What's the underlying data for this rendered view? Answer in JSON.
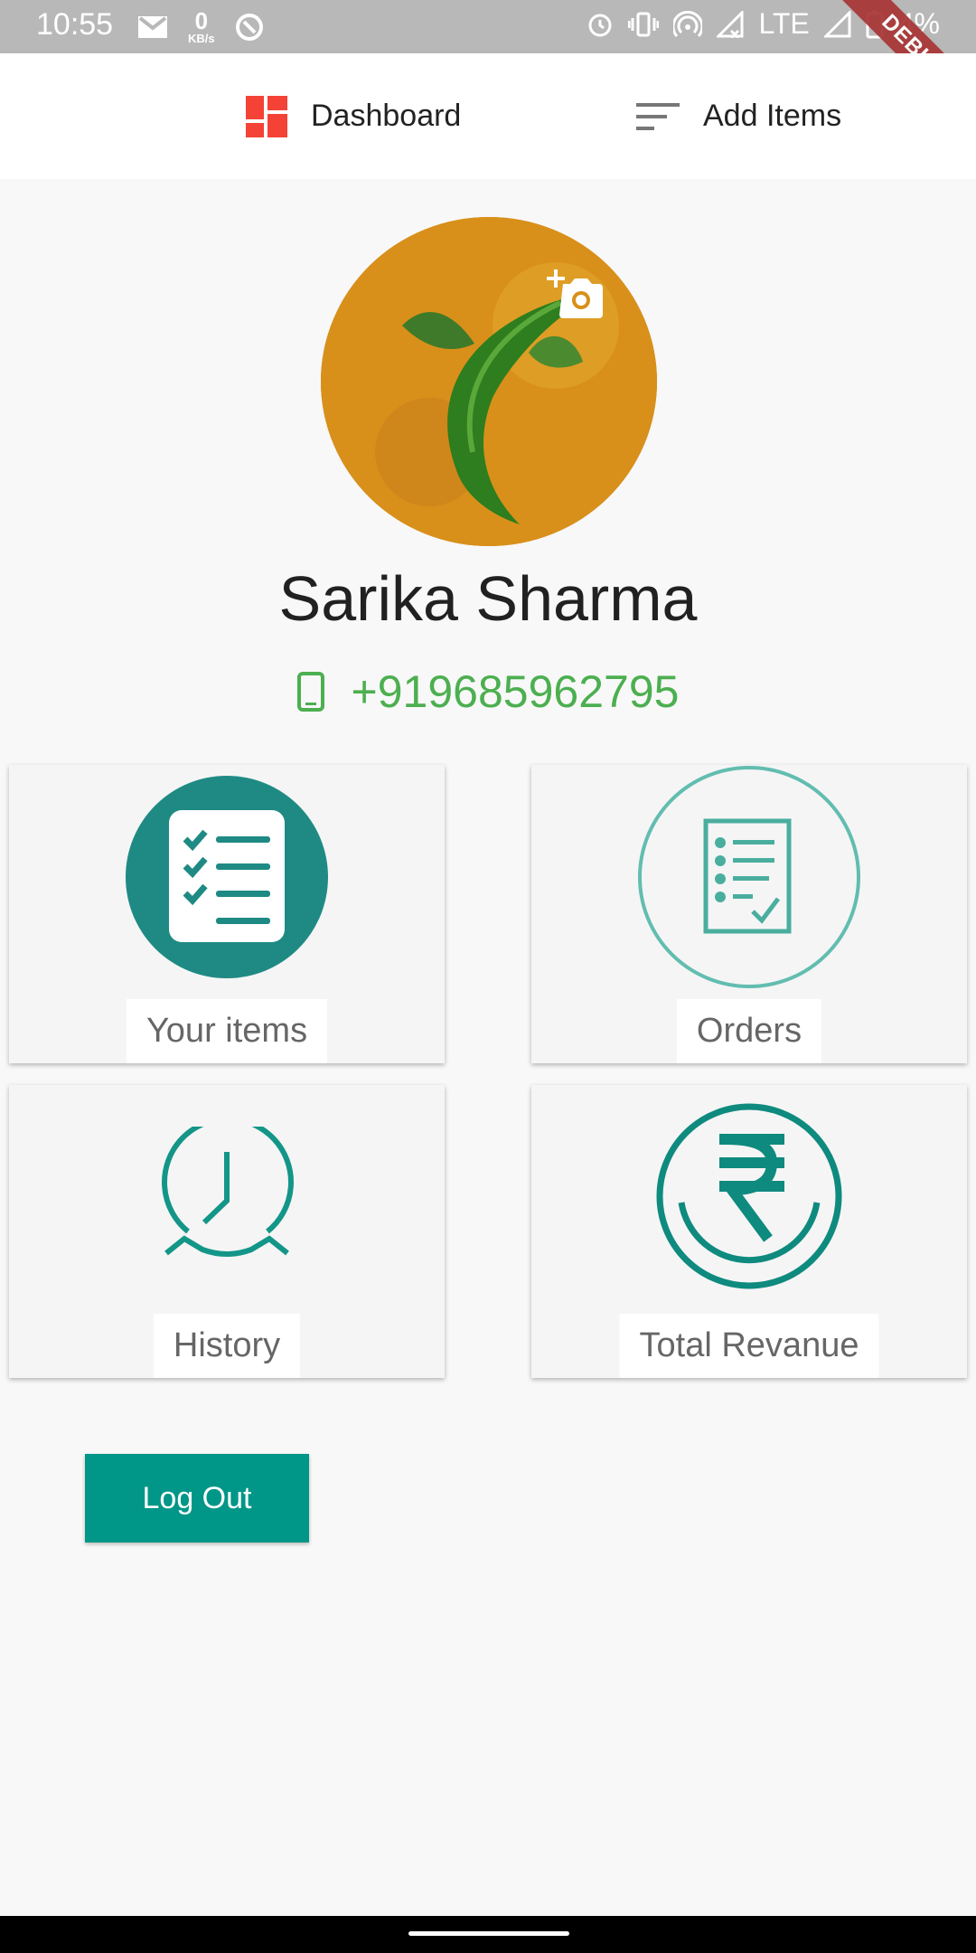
{
  "status_bar": {
    "time": "10:55",
    "data_rate_value": "0",
    "data_rate_unit": "KB/s",
    "network": "LTE",
    "battery": "4%",
    "icons": [
      "gmail-icon",
      "data-rate-icon",
      "sync-icon",
      "alarm-icon",
      "vibrate-icon",
      "hotspot-icon",
      "signal-icon",
      "battery-icon"
    ]
  },
  "debug_banner": "DEBUG",
  "appbar": {
    "dashboard_label": "Dashboard",
    "add_items_label": "Add Items",
    "dashboard_icon": "dashboard-icon",
    "add_items_icon": "sort-icon",
    "dashboard_icon_color": "#f44336"
  },
  "profile": {
    "name": "Sarika Sharma",
    "phone": "+919685962795",
    "phone_color": "#4caf50",
    "avatar_icon": "add-photo-icon"
  },
  "cards": [
    {
      "label": "Your items",
      "icon": "checklist-icon"
    },
    {
      "label": "Orders",
      "icon": "order-list-icon"
    },
    {
      "label": "History",
      "icon": "clock-icon"
    },
    {
      "label": "Total Revanue",
      "icon": "rupee-icon"
    }
  ],
  "logout_label": "Log Out",
  "accent_color": "#009688"
}
